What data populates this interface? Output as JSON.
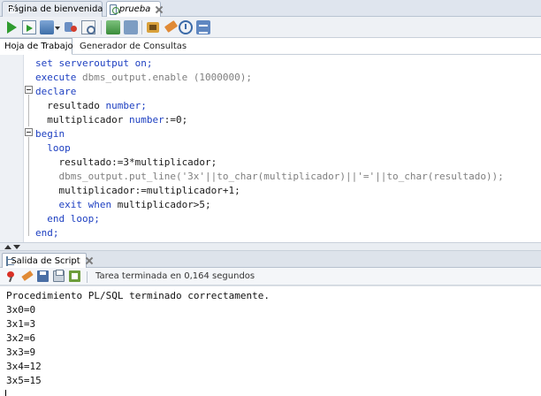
{
  "doc_tabs": [
    {
      "label": "Página de bienvenida",
      "icon": "oracle-db-icon"
    },
    {
      "label": "prueba",
      "icon": "sql-worksheet-icon"
    }
  ],
  "toolbar": {
    "buttons": [
      "run-statement-icon",
      "run-script-icon",
      "commit-icon",
      "rollback-icon",
      "find-icon",
      "autotrace-icon",
      "explain-plan-icon",
      "sql-tuning-icon",
      "clear-icon",
      "sql-history-icon",
      "format-icon"
    ]
  },
  "sub_tabs": [
    "Hoja de Trabajo",
    "Generador de Consultas"
  ],
  "editor": {
    "lines": [
      [
        [
          "kw",
          "set serveroutput on;"
        ]
      ],
      [
        [
          "kw",
          "execute "
        ],
        [
          "gr",
          "dbms_output.enable (1000000);"
        ]
      ],
      [
        [
          "kw",
          "declare"
        ]
      ],
      [
        [
          "bk",
          "  resultado "
        ],
        [
          "kw",
          "number;"
        ]
      ],
      [
        [
          "bk",
          "  multiplicador "
        ],
        [
          "kw",
          "number"
        ],
        [
          "bk",
          ":=0;"
        ]
      ],
      [
        [
          "kw",
          "begin"
        ]
      ],
      [
        [
          "kw",
          "  loop"
        ]
      ],
      [
        [
          "bk",
          "    resultado:=3*multiplicador;"
        ]
      ],
      [
        [
          "gr",
          "    dbms_output.put_line('3x'||to_char(multiplicador)||'='||to_char(resultado));"
        ]
      ],
      [
        [
          "bk",
          "    multiplicador:=multiplicador+1;"
        ]
      ],
      [
        [
          "kw",
          "    exit when "
        ],
        [
          "bk",
          "multiplicador>5;"
        ]
      ],
      [
        [
          "kw",
          "  end loop;"
        ]
      ],
      [
        [
          "kw",
          "end;"
        ]
      ],
      [
        [
          "bk",
          "/"
        ]
      ]
    ],
    "colors": {
      "kw": "#1d3fc1",
      "gr": "#7f7f7f",
      "bk": "#1a1a1a"
    }
  },
  "output_panel": {
    "tab_label": "Salida de Script",
    "status": "Tarea terminada en 0,164 segundos",
    "lines": [
      "Procedimiento PL/SQL terminado correctamente.",
      "3x0=0",
      "3x1=3",
      "3x2=6",
      "3x3=9",
      "3x4=12",
      "3x5=15"
    ]
  }
}
